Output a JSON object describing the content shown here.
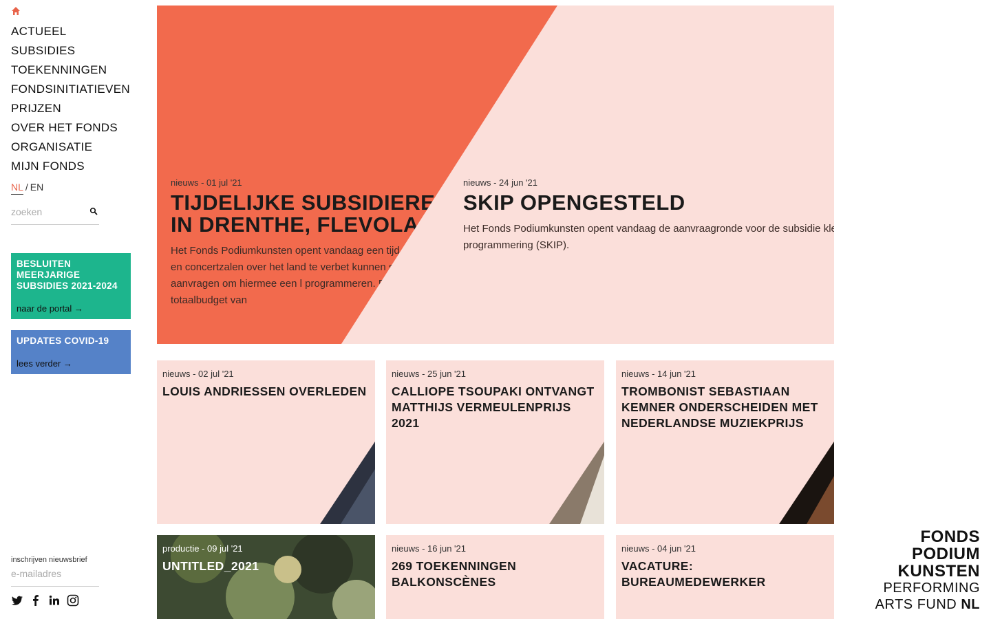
{
  "nav": {
    "home_icon": "home-icon",
    "items": [
      "ACTUEEL",
      "SUBSIDIES",
      "TOEKENNINGEN",
      "FONDSINITIATIEVEN",
      "PRIJZEN",
      "OVER HET FONDS",
      "ORGANISATIE",
      "MIJN FONDS"
    ]
  },
  "lang": {
    "active": "NL",
    "separator": "/",
    "other": "EN"
  },
  "search": {
    "placeholder": "zoeken",
    "icon": "search-icon"
  },
  "promos": [
    {
      "title": "BESLUITEN MEERJARIGE SUBSIDIES 2021-2024",
      "link": "naar de portal →",
      "color": "#1db58d"
    },
    {
      "title": "UPDATES COVID-19",
      "link": "lees verder →",
      "color": "#5582c8"
    }
  ],
  "newsletter": {
    "label": "inschrijven nieuwsbrief",
    "placeholder": "e-mailadres"
  },
  "social": [
    "twitter-icon",
    "facebook-icon",
    "linkedin-icon",
    "instagram-icon"
  ],
  "hero": {
    "left": {
      "meta": "nieuws - 01 jul '21",
      "title_1": "TIJDELIJKE SUBSIDIERE",
      "title_2": "IN DRENTHE, FLEVOLA",
      "text": "Het Fonds Podiumkunsten opent vandaag een tijd theaters en concertzalen over het land te verbet kunnen subsidie aanvragen om hiermee een l programmeren. Er is een totaalbudget van"
    },
    "right": {
      "meta": "nieuws - 24 jun '21",
      "title": "SKIP OPENGESTELD",
      "text": "Het Fonds Podiumkunsten opent vandaag de aanvraagronde voor de subsidie kle programmering (SKIP)."
    },
    "colors": {
      "orange": "#f26a4d",
      "pink": "#fbdfda"
    }
  },
  "cards": [
    {
      "meta": "nieuws - 02 jul '21",
      "title": "LOUIS ANDRIESSEN OVERLEDEN"
    },
    {
      "meta": "nieuws - 25 jun '21",
      "title": "CALLIOPE TSOUPAKI ONTVANGT MATTHIJS VERMEULENPRIJS 2021"
    },
    {
      "meta": "nieuws - 14 jun '21",
      "title": "TROMBONIST SEBASTIAAN KEMNER ONDERSCHEIDEN MET NEDERLANDSE MUZIEKPRIJS"
    },
    {
      "meta": "productie - 09 jul '21",
      "title": "UNTITLED_2021"
    },
    {
      "meta": "nieuws - 16 jun '21",
      "title": "269 TOEKENNINGEN BALKONSCÈNES"
    },
    {
      "meta": "nieuws - 04 jun '21",
      "title": "VACATURE: BUREAUMEDEWERKER"
    }
  ],
  "logo": {
    "line1": "FONDS",
    "line2": "PODIUM",
    "line3": "KUNSTEN",
    "line4": "PERFORMING",
    "line5a": "ARTS FUND",
    "line5b": "NL"
  }
}
